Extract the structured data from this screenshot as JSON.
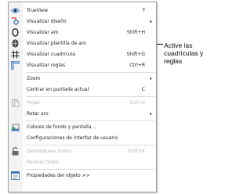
{
  "menu": {
    "items": [
      {
        "icon": "eye-icon",
        "label": "TrueView",
        "shortcut": "T",
        "submenu": false,
        "disabled": false
      },
      {
        "icon": "display-design-icon",
        "label": "Visualizar diseño",
        "shortcut": "",
        "submenu": true,
        "disabled": false
      },
      {
        "icon": "hoop-icon",
        "label": "Visualizar aro",
        "shortcut": "Shift+H",
        "submenu": false,
        "disabled": false
      },
      {
        "icon": "hoop-template-icon",
        "label": "Visualizar plantilla de aro",
        "shortcut": "",
        "submenu": false,
        "disabled": false
      },
      {
        "icon": "grid-icon",
        "label": "Visualizar cuadrícula",
        "shortcut": "Shift+G",
        "submenu": false,
        "disabled": false
      },
      {
        "icon": "rulers-icon",
        "label": "Visualizar reglas",
        "shortcut": "Ctrl+R",
        "submenu": false,
        "disabled": false
      },
      {
        "icon": "",
        "label": "Zoom",
        "shortcut": "",
        "submenu": true,
        "disabled": false
      },
      {
        "icon": "",
        "label": "Centrar en puntada actual",
        "shortcut": "C",
        "submenu": false,
        "disabled": false
      },
      {
        "icon": "paste-icon",
        "label": "Pegar",
        "shortcut": "Ctrl+V",
        "submenu": false,
        "disabled": true
      },
      {
        "icon": "",
        "label": "Rotar aro",
        "shortcut": "",
        "submenu": true,
        "disabled": false
      },
      {
        "icon": "background-colors-icon",
        "label": "Colores de fondo y pantalla...",
        "shortcut": "",
        "submenu": false,
        "disabled": false
      },
      {
        "icon": "",
        "label": "Configuraciones de interfaz de usuario",
        "shortcut": "",
        "submenu": false,
        "disabled": false
      },
      {
        "icon": "unlock-icon",
        "label": "Desbloquear todos",
        "shortcut": "Shift+K",
        "submenu": false,
        "disabled": true
      },
      {
        "icon": "",
        "label": "Revelar todos",
        "shortcut": "",
        "submenu": false,
        "disabled": true
      },
      {
        "icon": "object-properties-icon",
        "label": "Propiedades del objeto >>",
        "shortcut": "",
        "submenu": false,
        "disabled": false
      }
    ]
  },
  "callout": {
    "lines": [
      "Active las",
      "cuadrículas y",
      "reglas"
    ]
  },
  "colors": {
    "menu_border": "#a0a0a0",
    "disabled_text": "#b4b4b4",
    "icon_blue": "#2b6cb0",
    "icon_red": "#d23c3c"
  }
}
